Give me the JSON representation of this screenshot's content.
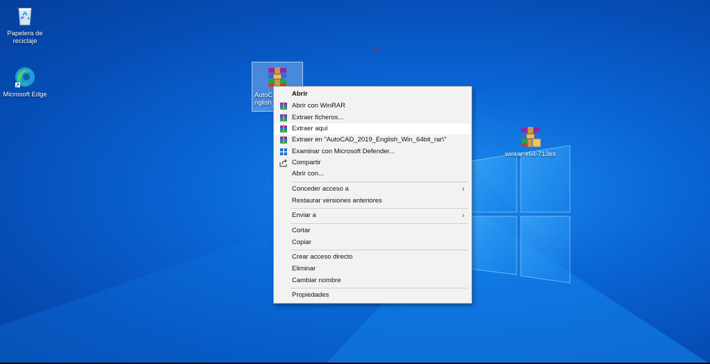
{
  "desktop": {
    "icons": [
      {
        "id": "recycle",
        "label": "Papelera de\nreciclaje",
        "icon": "recycle-bin-icon"
      },
      {
        "id": "edge",
        "label": "Microsoft Edge",
        "icon": "edge-icon"
      },
      {
        "id": "autocad",
        "label": "AutoCA\nnglish_",
        "icon": "winrar-archive-icon"
      },
      {
        "id": "winrar",
        "label": "winrar-x64-713es",
        "icon": "winrar-installer-icon"
      }
    ]
  },
  "context_menu": {
    "items": [
      {
        "label": "Abrir",
        "icon": "",
        "bold": true
      },
      {
        "label": "Abrir con WinRAR",
        "icon": "winrar-icon"
      },
      {
        "label": "Extraer ficheros...",
        "icon": "winrar-icon"
      },
      {
        "label": "Extraer aquí",
        "icon": "winrar-icon",
        "highlighted": true
      },
      {
        "label": "Extraer en \"AutoCAD_2019_English_Win_64bit_rar\\\"",
        "icon": "winrar-icon"
      },
      {
        "label": "Examinar con Microsoft Defender...",
        "icon": "defender-icon"
      },
      {
        "label": "Compartir",
        "icon": "share-icon"
      },
      {
        "label": "Abrir con...",
        "icon": ""
      },
      {
        "label": "Conceder acceso a",
        "icon": "",
        "submenu": true
      },
      {
        "label": "Restaurar versiones anteriores",
        "icon": ""
      },
      {
        "label": "Enviar a",
        "icon": "",
        "submenu": true
      },
      {
        "label": "Cortar",
        "icon": ""
      },
      {
        "label": "Copiar",
        "icon": ""
      },
      {
        "label": "Crear acceso directo",
        "icon": ""
      },
      {
        "label": "Eliminar",
        "icon": ""
      },
      {
        "label": "Cambiar nombre",
        "icon": ""
      },
      {
        "label": "Propiedades",
        "icon": ""
      }
    ]
  }
}
